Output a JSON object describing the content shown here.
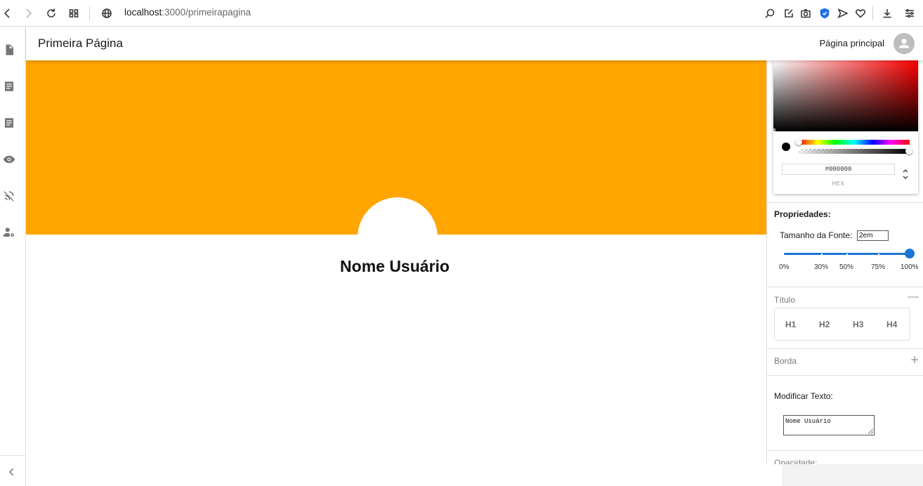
{
  "browser": {
    "url_host": "localhost",
    "url_rest": ":3000/primeirapagina"
  },
  "app": {
    "title": "Primeira Página",
    "home_link": "Página principal"
  },
  "canvas": {
    "banner_color": "#FFA500",
    "user_name": "Nome Usuário"
  },
  "color_picker": {
    "hex_value": "#000000",
    "mode_label": "HEX",
    "current_color": "#000000",
    "hue_color": "#FF0000"
  },
  "properties": {
    "title": "Propriedades:",
    "font_size_label": "Tamanho da Fonte:",
    "font_size_value": "2em",
    "slider_value_percent": 100,
    "slider_marks": [
      "0%",
      "30%",
      "50%",
      "75%",
      "100%"
    ]
  },
  "titulo": {
    "label": "Título",
    "buttons": [
      "H1",
      "H2",
      "H3",
      "H4"
    ]
  },
  "borda": {
    "label": "Borda"
  },
  "modificar": {
    "label": "Modificar Texto:",
    "value": "Nome Usuário"
  },
  "opacity": {
    "label": "Opacidade:"
  },
  "rail": {
    "icons": [
      "file-icon",
      "article-icon",
      "article-icon-2",
      "eye-icon",
      "signal-icon",
      "user-settings-icon"
    ],
    "collapse_icon": "chevron-left-icon"
  }
}
